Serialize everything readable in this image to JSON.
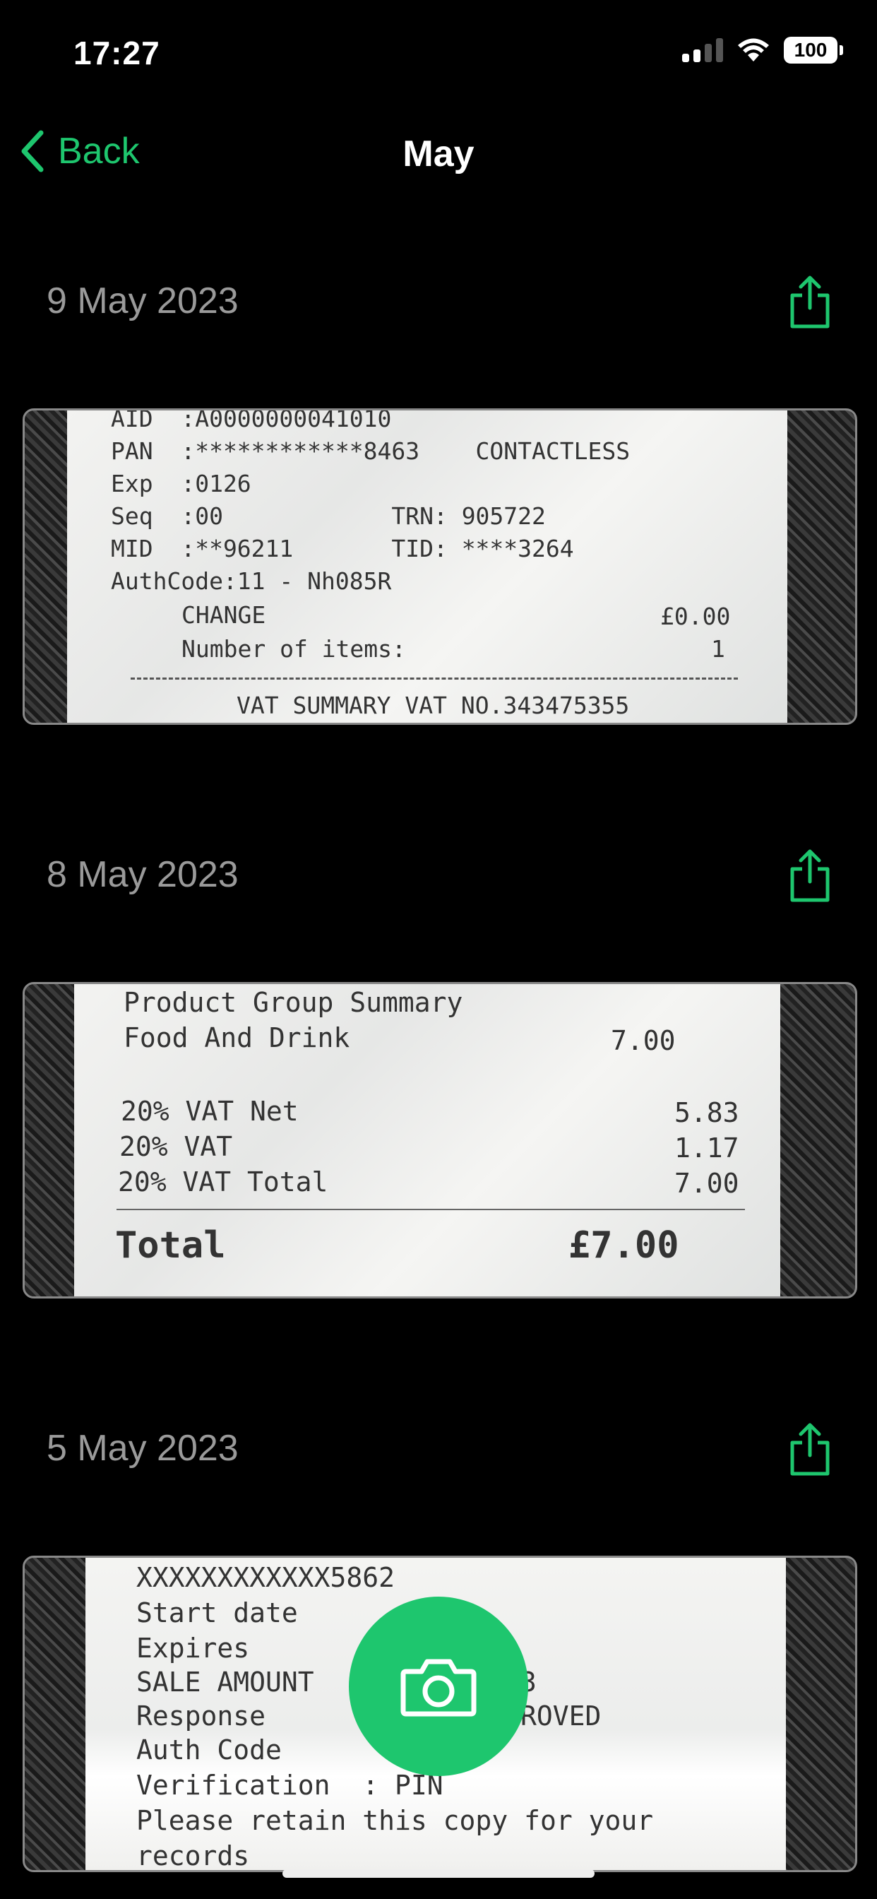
{
  "status": {
    "time": "17:27",
    "battery": "100"
  },
  "nav": {
    "back_label": "Back",
    "title": "May"
  },
  "colors": {
    "accent": "#1ec66e"
  },
  "entries": [
    {
      "date": "9 May 2023",
      "receipt_lines": [
        "AID  :A0000000041010",
        "PAN  :************8463    CONTACTLESS",
        "Exp  :0126",
        "Seq  :00            TRN: 905722",
        "MID  :**96211       TID: ****3264",
        "AuthCode:11 - Nh085R",
        "CHANGE",
        "£0.00",
        "Number of items:",
        "1",
        "VAT SUMMARY VAT NO.343475355"
      ]
    },
    {
      "date": "8 May 2023",
      "receipt_lines": [
        "Product Group Summary",
        "Food And Drink",
        "7.00",
        "20% VAT Net",
        "5.83",
        "20% VAT",
        "1.17",
        "20% VAT Total",
        "7.00",
        "Total",
        "£7.00"
      ]
    },
    {
      "date": "5 May 2023",
      "receipt_lines": [
        "XXXXXXXXXXXX5862",
        "Start date",
        "Expires",
        "SALE AMOUNT",
        "3",
        "Response",
        "ROVED",
        "Auth Code",
        "Verification  : PIN",
        "Please retain this copy for your",
        "records"
      ]
    }
  ],
  "icons": {
    "back": "chevron-left-icon",
    "share": "share-icon",
    "camera": "camera-icon"
  }
}
